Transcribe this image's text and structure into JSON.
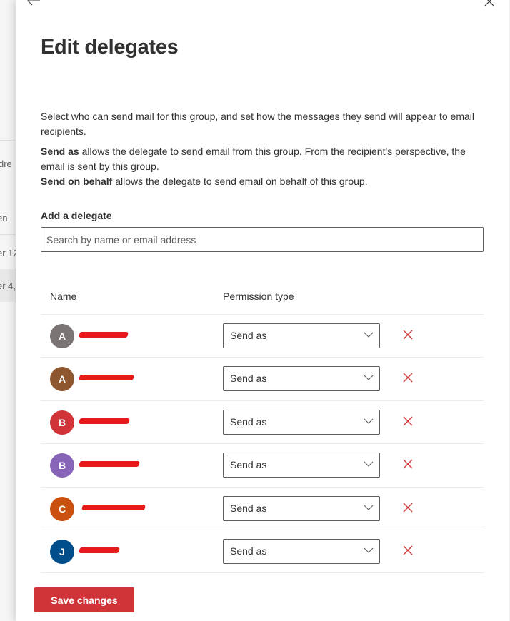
{
  "background_page": {
    "fragments": [
      {
        "text": "dre"
      },
      {
        "text": "en"
      },
      {
        "text": "er 12"
      },
      {
        "text": "er 4,"
      }
    ]
  },
  "panel": {
    "back_icon": "arrow-left-icon",
    "close_icon": "close-icon",
    "title": "Edit delegates",
    "description": "Select who can send mail for this group, and set how the messages they send will appear to email recipients.",
    "send_as_term": "Send as",
    "send_as_text": " allows the delegate to send email from this group. From the recipient's perspective, the email is sent by this group.",
    "send_on_behalf_term": "Send on behalf",
    "send_on_behalf_text": " allows the delegate to send email on behalf of this group.",
    "add_delegate_label": "Add a delegate",
    "search_placeholder": "Search by name or email address",
    "search_value": ""
  },
  "table": {
    "columns": [
      "Name",
      "Permission type"
    ],
    "rows": [
      {
        "initial": "A",
        "avatar_color": "#7a7574",
        "name": "[redacted]",
        "permission": "Send as"
      },
      {
        "initial": "A",
        "avatar_color": "#8e562e",
        "name": "[redacted]",
        "permission": "Send as"
      },
      {
        "initial": "B",
        "avatar_color": "#d13438",
        "name": "[redacted]",
        "permission": "Send as"
      },
      {
        "initial": "B",
        "avatar_color": "#8764b8",
        "name": "[redacted]",
        "permission": "Send as"
      },
      {
        "initial": "C",
        "avatar_color": "#ca5010",
        "name": "[redacted]",
        "permission": "Send as"
      },
      {
        "initial": "J",
        "avatar_color": "#004e8c",
        "name": "[redacted]",
        "permission": "Send as"
      }
    ]
  },
  "footer": {
    "save_label": "Save changes"
  },
  "colors": {
    "accent": "#d13438",
    "remove_icon": "#d13438",
    "redaction": "#e50000"
  }
}
